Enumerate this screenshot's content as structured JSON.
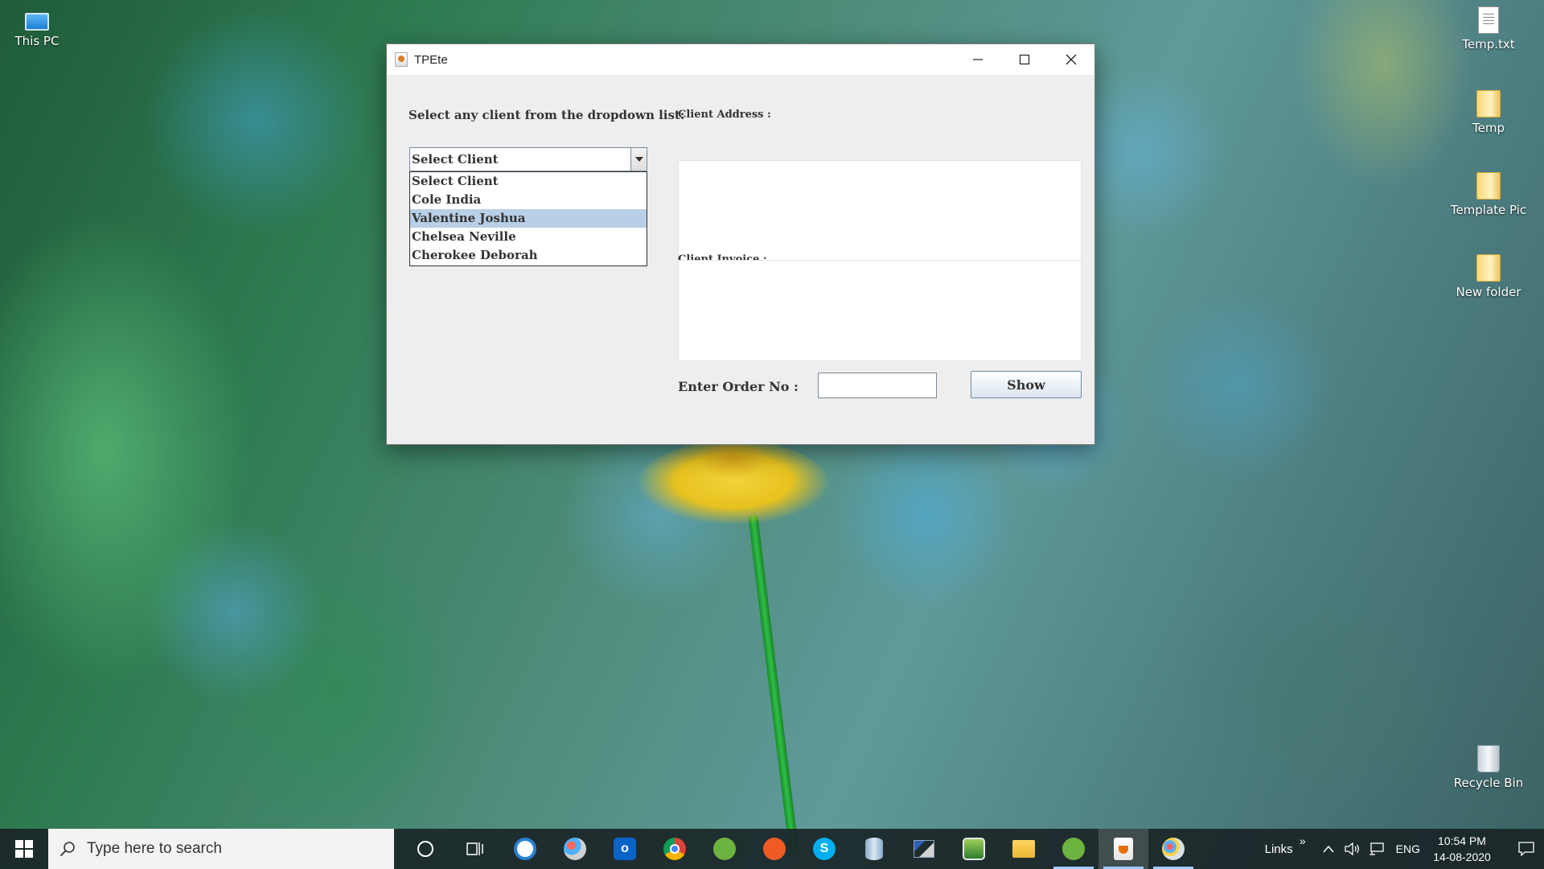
{
  "desktop": {
    "icons_left": [
      {
        "label": "This PC",
        "icon": "this-pc-icon"
      }
    ],
    "icons_right": [
      {
        "label": "Temp.txt",
        "icon": "text-file-icon"
      },
      {
        "label": "Temp",
        "icon": "folder-icon"
      },
      {
        "label": "Template Pic",
        "icon": "folder-icon"
      },
      {
        "label": "New folder",
        "icon": "folder-icon"
      },
      {
        "label": "Recycle Bin",
        "icon": "recycle-bin-icon"
      }
    ]
  },
  "window": {
    "title": "TPEte",
    "select_label": "Select any client from the dropdown list:",
    "address_label": "Client Address :",
    "invoice_label": "Client Invoice :",
    "combo": {
      "selected": "Select Client",
      "options": [
        "Select Client",
        "Cole India",
        "Valentine Joshua",
        "Chelsea Neville",
        "Cherokee Deborah"
      ],
      "highlighted_index": 2
    },
    "address_value": "",
    "invoice_value": "",
    "order_label": "Enter Order No :",
    "order_value": "",
    "show_label": "Show"
  },
  "taskbar": {
    "search_placeholder": "Type here to search",
    "links_label": "Links",
    "language": "ENG",
    "time": "10:54 PM",
    "date": "14-08-2020"
  },
  "colors": {
    "highlight": "#b8cfe5",
    "taskbar": "#1b2628",
    "accent": "#9ecbff"
  }
}
